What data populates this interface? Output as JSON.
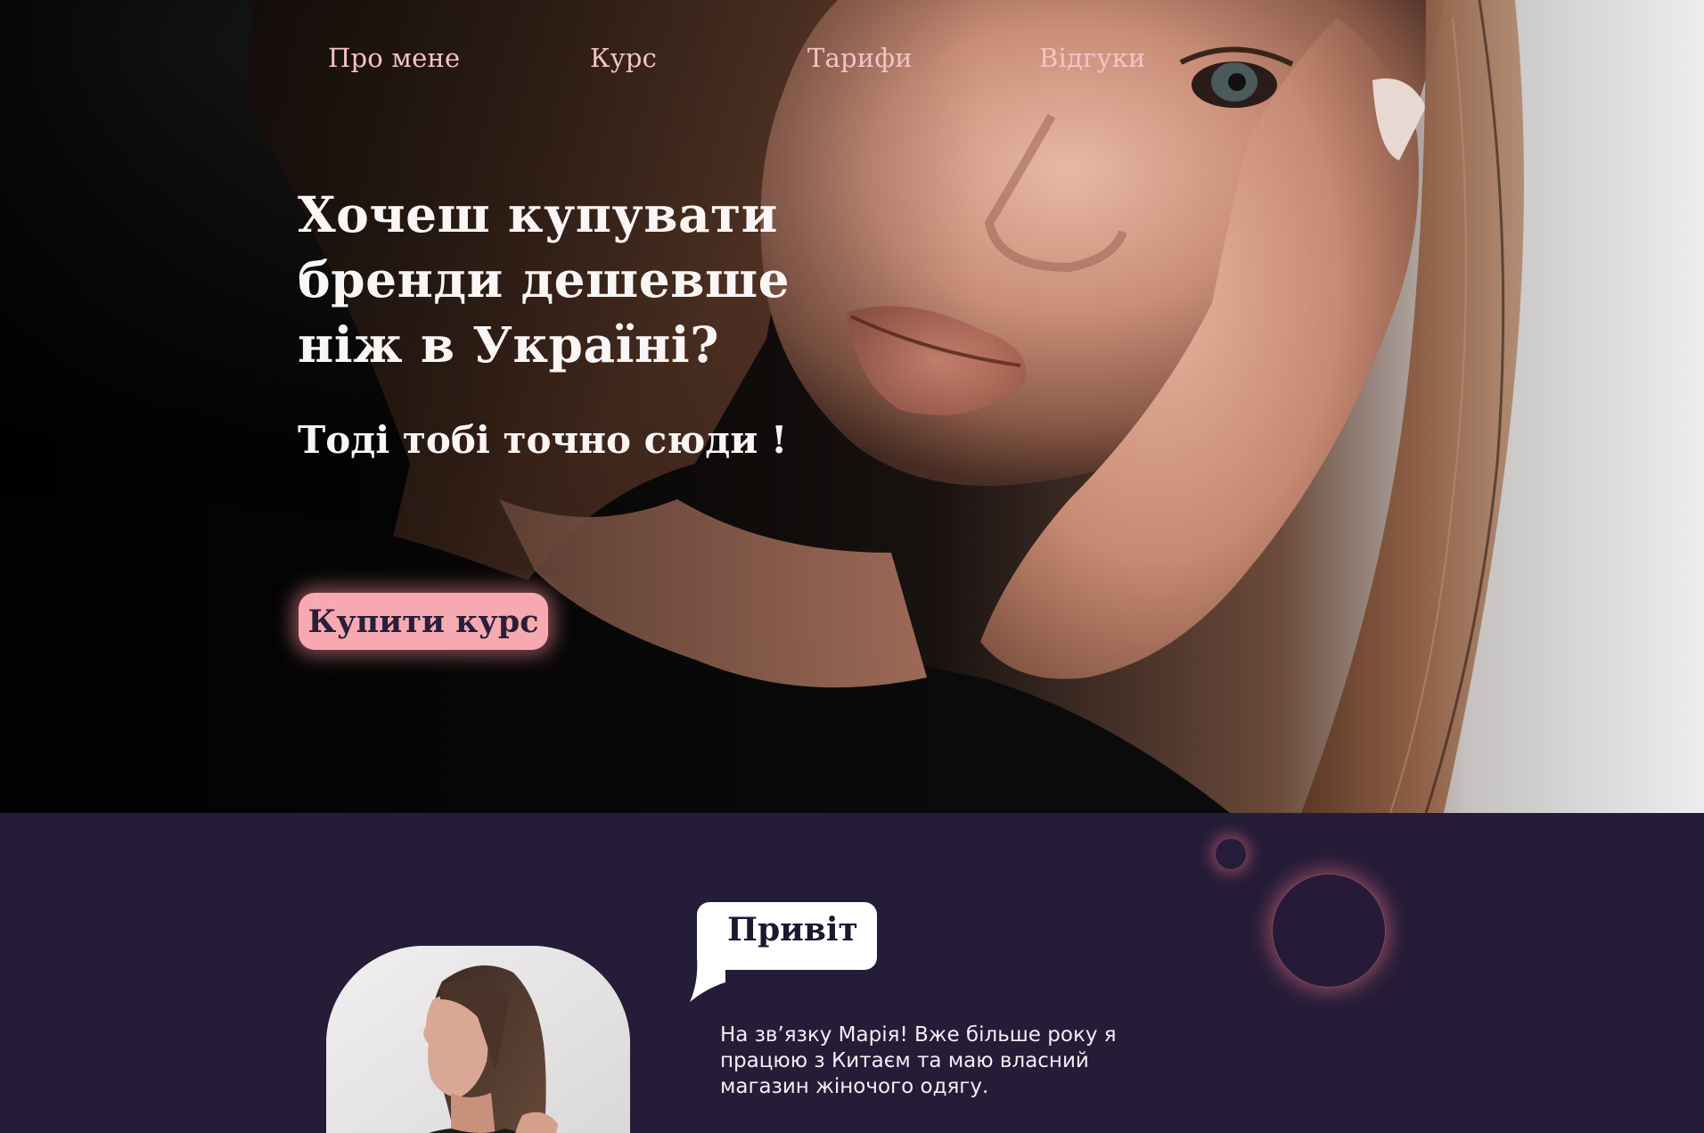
{
  "nav": {
    "items": [
      {
        "label": "Про мене"
      },
      {
        "label": "Курс"
      },
      {
        "label": "Тарифи"
      },
      {
        "label": "Відгуки"
      }
    ]
  },
  "hero": {
    "title": "Хочеш купувати бренди дешевше ніж в Україні?",
    "subtitle": "Тоді тобі точно сюди !",
    "cta_label": "Купити курс"
  },
  "about": {
    "greeting": "Привіт",
    "text": "На зв’язку Марія! Вже більше року я працюю з Китаєм та маю власний магазин жіночого одягу."
  },
  "colors": {
    "accent_pink": "#f7a9b2",
    "nav_text": "#f6c2c8",
    "section_bg": "#251c38"
  }
}
